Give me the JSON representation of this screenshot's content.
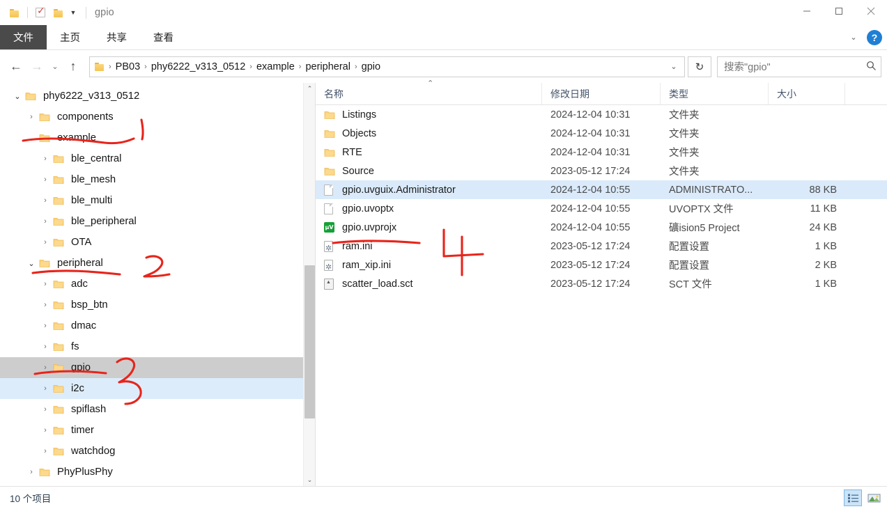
{
  "window": {
    "title": "gpio",
    "quick_access": [
      "folder-icon",
      "properties-icon",
      "new-folder-icon",
      "customize-caret-icon"
    ],
    "controls": {
      "minimize": "minimize-icon",
      "maximize": "maximize-icon",
      "close": "close-icon"
    }
  },
  "ribbon": {
    "tabs": [
      {
        "label": "文件",
        "active": true
      },
      {
        "label": "主页",
        "active": false
      },
      {
        "label": "共享",
        "active": false
      },
      {
        "label": "查看",
        "active": false
      }
    ],
    "collapse_icon": "chevron-down-icon",
    "help_icon": "?"
  },
  "nav": {
    "back": "←",
    "forward": "→",
    "recent": "⌄",
    "up": "↑",
    "breadcrumbs": [
      "PB03",
      "phy6222_v313_0512",
      "example",
      "peripheral",
      "gpio"
    ],
    "breadcrumb_separator": "›",
    "dropdown_icon": "chevron-down-icon",
    "refresh_icon": "↻"
  },
  "search": {
    "placeholder": "搜索\"gpio\"",
    "icon": "search-icon"
  },
  "tree": {
    "items": [
      {
        "label": "phy6222_v313_0512",
        "indent": 0,
        "state": "expanded",
        "selected": false,
        "hover": false
      },
      {
        "label": "components",
        "indent": 1,
        "state": "collapsed",
        "selected": false,
        "hover": false
      },
      {
        "label": "example",
        "indent": 1,
        "state": "expanded",
        "selected": false,
        "hover": false
      },
      {
        "label": "ble_central",
        "indent": 2,
        "state": "collapsed",
        "selected": false,
        "hover": false
      },
      {
        "label": "ble_mesh",
        "indent": 2,
        "state": "collapsed",
        "selected": false,
        "hover": false
      },
      {
        "label": "ble_multi",
        "indent": 2,
        "state": "collapsed",
        "selected": false,
        "hover": false
      },
      {
        "label": "ble_peripheral",
        "indent": 2,
        "state": "collapsed",
        "selected": false,
        "hover": false
      },
      {
        "label": "OTA",
        "indent": 2,
        "state": "collapsed",
        "selected": false,
        "hover": false
      },
      {
        "label": "peripheral",
        "indent": 1,
        "state": "expanded",
        "selected": false,
        "hover": false
      },
      {
        "label": "adc",
        "indent": 2,
        "state": "collapsed",
        "selected": false,
        "hover": false
      },
      {
        "label": "bsp_btn",
        "indent": 2,
        "state": "collapsed",
        "selected": false,
        "hover": false
      },
      {
        "label": "dmac",
        "indent": 2,
        "state": "collapsed",
        "selected": false,
        "hover": false
      },
      {
        "label": "fs",
        "indent": 2,
        "state": "collapsed",
        "selected": false,
        "hover": false
      },
      {
        "label": "gpio",
        "indent": 2,
        "state": "collapsed",
        "selected": true,
        "hover": false
      },
      {
        "label": "i2c",
        "indent": 2,
        "state": "collapsed",
        "selected": false,
        "hover": true
      },
      {
        "label": "spiflash",
        "indent": 2,
        "state": "collapsed",
        "selected": false,
        "hover": false
      },
      {
        "label": "timer",
        "indent": 2,
        "state": "collapsed",
        "selected": false,
        "hover": false
      },
      {
        "label": "watchdog",
        "indent": 2,
        "state": "collapsed",
        "selected": false,
        "hover": false
      },
      {
        "label": "PhyPlusPhy",
        "indent": 1,
        "state": "collapsed",
        "selected": false,
        "hover": false
      },
      {
        "label": "...",
        "indent": 1,
        "state": "none",
        "selected": false,
        "hover": false
      }
    ]
  },
  "list": {
    "columns": [
      {
        "key": "name",
        "label": "名称",
        "sorted": "asc"
      },
      {
        "key": "date",
        "label": "修改日期"
      },
      {
        "key": "type",
        "label": "类型"
      },
      {
        "key": "size",
        "label": "大小"
      }
    ],
    "rows": [
      {
        "name": "Listings",
        "date": "2024-12-04 10:31",
        "type": "文件夹",
        "size": "",
        "icon": "folder-icon",
        "selected": false
      },
      {
        "name": "Objects",
        "date": "2024-12-04 10:31",
        "type": "文件夹",
        "size": "",
        "icon": "folder-icon",
        "selected": false
      },
      {
        "name": "RTE",
        "date": "2024-12-04 10:31",
        "type": "文件夹",
        "size": "",
        "icon": "folder-icon",
        "selected": false
      },
      {
        "name": "Source",
        "date": "2023-05-12 17:24",
        "type": "文件夹",
        "size": "",
        "icon": "folder-icon",
        "selected": false
      },
      {
        "name": "gpio.uvguix.Administrator",
        "date": "2024-12-04 10:55",
        "type": "ADMINISTRATO...",
        "size": "88 KB",
        "icon": "generic-file-icon",
        "selected": true
      },
      {
        "name": "gpio.uvoptx",
        "date": "2024-12-04 10:55",
        "type": "UVOPTX 文件",
        "size": "11 KB",
        "icon": "generic-file-icon",
        "selected": false
      },
      {
        "name": "gpio.uvprojx",
        "date": "2024-12-04 10:55",
        "type": "礦ision5 Project",
        "size": "24 KB",
        "icon": "uvision-project-icon",
        "selected": false
      },
      {
        "name": "ram.ini",
        "date": "2023-05-12 17:24",
        "type": "配置设置",
        "size": "1 KB",
        "icon": "config-file-icon",
        "selected": false
      },
      {
        "name": "ram_xip.ini",
        "date": "2023-05-12 17:24",
        "type": "配置设置",
        "size": "2 KB",
        "icon": "config-file-icon",
        "selected": false
      },
      {
        "name": "scatter_load.sct",
        "date": "2023-05-12 17:24",
        "type": "SCT 文件",
        "size": "1 KB",
        "icon": "sct-file-icon",
        "selected": false
      }
    ]
  },
  "status": {
    "item_count": "10 个项目",
    "views": [
      {
        "name": "details-view",
        "active": true
      },
      {
        "name": "large-icons-view",
        "active": false
      }
    ]
  },
  "annotations": {
    "color": "#e8241b",
    "marks": [
      {
        "label": "1",
        "near": "example"
      },
      {
        "label": "2",
        "near": "peripheral"
      },
      {
        "label": "3",
        "near": "gpio"
      },
      {
        "label": "4",
        "near": "gpio.uvprojx"
      }
    ]
  }
}
